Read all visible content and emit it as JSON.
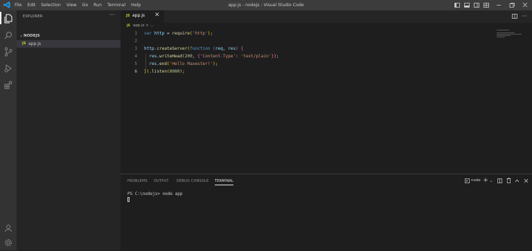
{
  "window": {
    "title": "app.js - nodejs - Visual Studio Code",
    "menu": [
      "File",
      "Edit",
      "Selection",
      "View",
      "Go",
      "Run",
      "Terminal",
      "Help"
    ],
    "controls": [
      "layout-sidebar-icon",
      "layout-panel-icon",
      "layout-secondary-icon",
      "layout-custom-icon",
      "minimize-icon",
      "restore-icon",
      "close-icon"
    ]
  },
  "activity_bar": [
    "explorer-icon",
    "search-icon",
    "source-control-icon",
    "run-debug-icon",
    "extensions-icon",
    "account-icon",
    "settings-icon"
  ],
  "sidebar": {
    "header": "EXPLORER",
    "more": "···",
    "folder": "NODEJS",
    "files": [
      {
        "badge": "JS",
        "name": "app.js"
      }
    ]
  },
  "editor": {
    "tab": {
      "badge": "JS",
      "name": "app.js",
      "close": "✕"
    },
    "actions": [
      "split-editor-icon",
      "more-icon"
    ],
    "breadcrumb": {
      "badge": "JS",
      "text": "app.js > ..."
    },
    "active_line": 6,
    "lines": [
      "var http = require('http');",
      "",
      "http.createServer(function (req, res) {",
      "  res.writeHead(200, {'Content-Type': 'text/plain'});",
      "  res.end('Hello Maxester!');",
      "}).listen(8080);"
    ]
  },
  "panel": {
    "tabs": [
      "PROBLEMS",
      "OUTPUT",
      "DEBUG CONSOLE",
      "TERMINAL"
    ],
    "active_tab": "TERMINAL",
    "terminal_name": "node",
    "terminal": {
      "prompt_line": "PS C:\\nodejs> node app"
    }
  },
  "colors": {
    "background": "#1e1e1e",
    "sidebar": "#252526",
    "activity_bar": "#333333",
    "title_bar": "#3c3c3c",
    "accent": "#007acc",
    "js_badge": "#cbcb41"
  }
}
